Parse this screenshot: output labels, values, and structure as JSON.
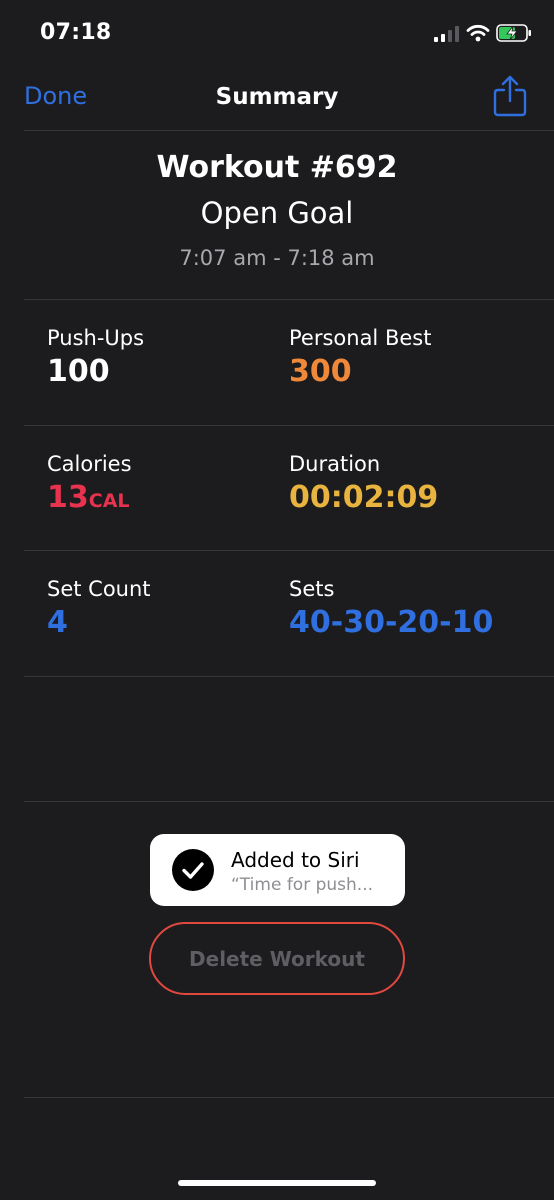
{
  "status_bar": {
    "time": "07:18"
  },
  "nav": {
    "done_label": "Done",
    "title": "Summary"
  },
  "workout": {
    "title": "Workout #692",
    "goal": "Open Goal",
    "time_range": "7:07 am - 7:18 am"
  },
  "stats": {
    "pushups": {
      "label": "Push-Ups",
      "value": "100"
    },
    "personal_best": {
      "label": "Personal Best",
      "value": "300"
    },
    "calories": {
      "label": "Calories",
      "value": "13",
      "unit": "CAL"
    },
    "duration": {
      "label": "Duration",
      "value": "00:02:09"
    },
    "set_count": {
      "label": "Set Count",
      "value": "4"
    },
    "sets": {
      "label": "Sets",
      "value": "40-30-20-10"
    }
  },
  "toast": {
    "title": "Added to Siri",
    "subtitle": "“Time for push..."
  },
  "actions": {
    "delete_label": "Delete Workout"
  },
  "colors": {
    "background": "#1c1c1e",
    "accent_blue": "#2f6fe0",
    "personal_best": "#f0883a",
    "calories": "#e8334f",
    "duration": "#e8b33e",
    "delete_border": "#e0493f"
  },
  "icons": [
    "signal-icon",
    "wifi-icon",
    "battery-charging-icon",
    "share-icon",
    "checkmark-icon"
  ]
}
